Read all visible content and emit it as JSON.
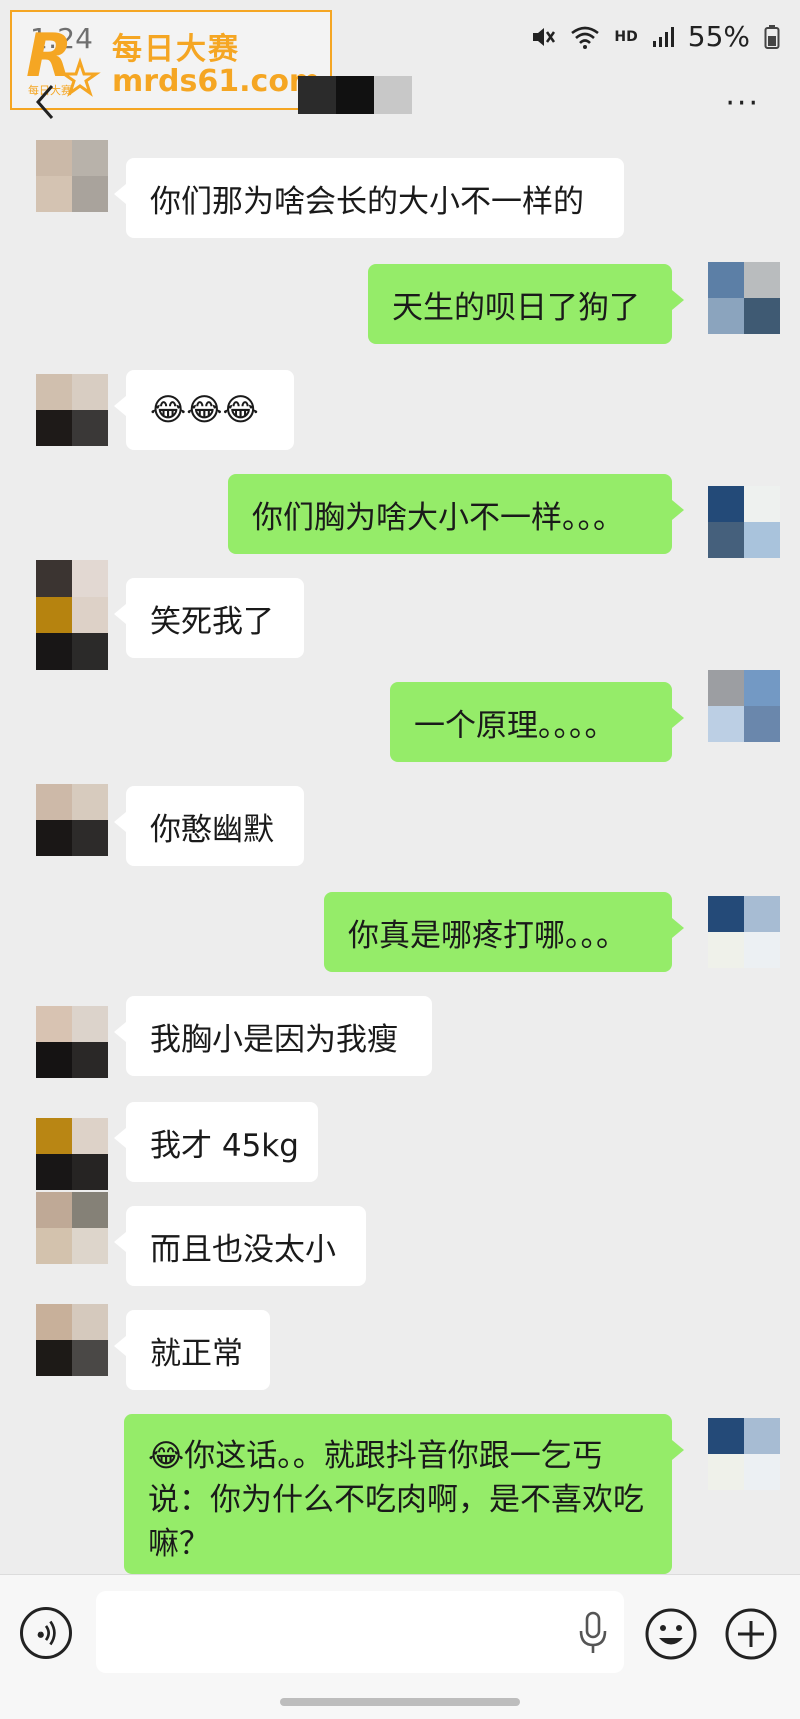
{
  "status_bar": {
    "time": "1:24",
    "network_label": "HD",
    "battery": "55%"
  },
  "watermark": {
    "title": "每日大赛",
    "url": "mrds61.com",
    "logo_letter": "R",
    "logo_tag": "每日大赛"
  },
  "nav": {
    "more": "···"
  },
  "colors": {
    "background": "#ededed",
    "bubble_self": "#95ec69",
    "bubble_other": "#ffffff",
    "watermark": "#f5a623"
  },
  "messages": [
    {
      "side": "left",
      "text": "你们那为啥会长的大小不一样的"
    },
    {
      "side": "right",
      "text": "天生的呗日了狗了"
    },
    {
      "side": "left",
      "text": "😂😂😂"
    },
    {
      "side": "right",
      "text": "你们胸为啥大小不一样。。。"
    },
    {
      "side": "left",
      "text": "笑死我了"
    },
    {
      "side": "right",
      "text": "一个原理。。。。"
    },
    {
      "side": "left",
      "text": "你憨幽默"
    },
    {
      "side": "right",
      "text": "你真是哪疼打哪。。。"
    },
    {
      "side": "left",
      "text": "我胸小是因为我瘦"
    },
    {
      "side": "left",
      "text": "我才 45kg"
    },
    {
      "side": "left",
      "text": "而且也没太小"
    },
    {
      "side": "left",
      "text": "就正常"
    },
    {
      "side": "right",
      "text": "😂你这话。。就跟抖音你跟一乞丐说：你为什么不吃肉啊，是不喜欢吃嘛？"
    }
  ],
  "input_bar": {
    "voice_icon": "voice-icon",
    "mic_icon": "mic-icon",
    "emoji_icon": "emoji-icon",
    "plus_icon": "plus-icon"
  }
}
